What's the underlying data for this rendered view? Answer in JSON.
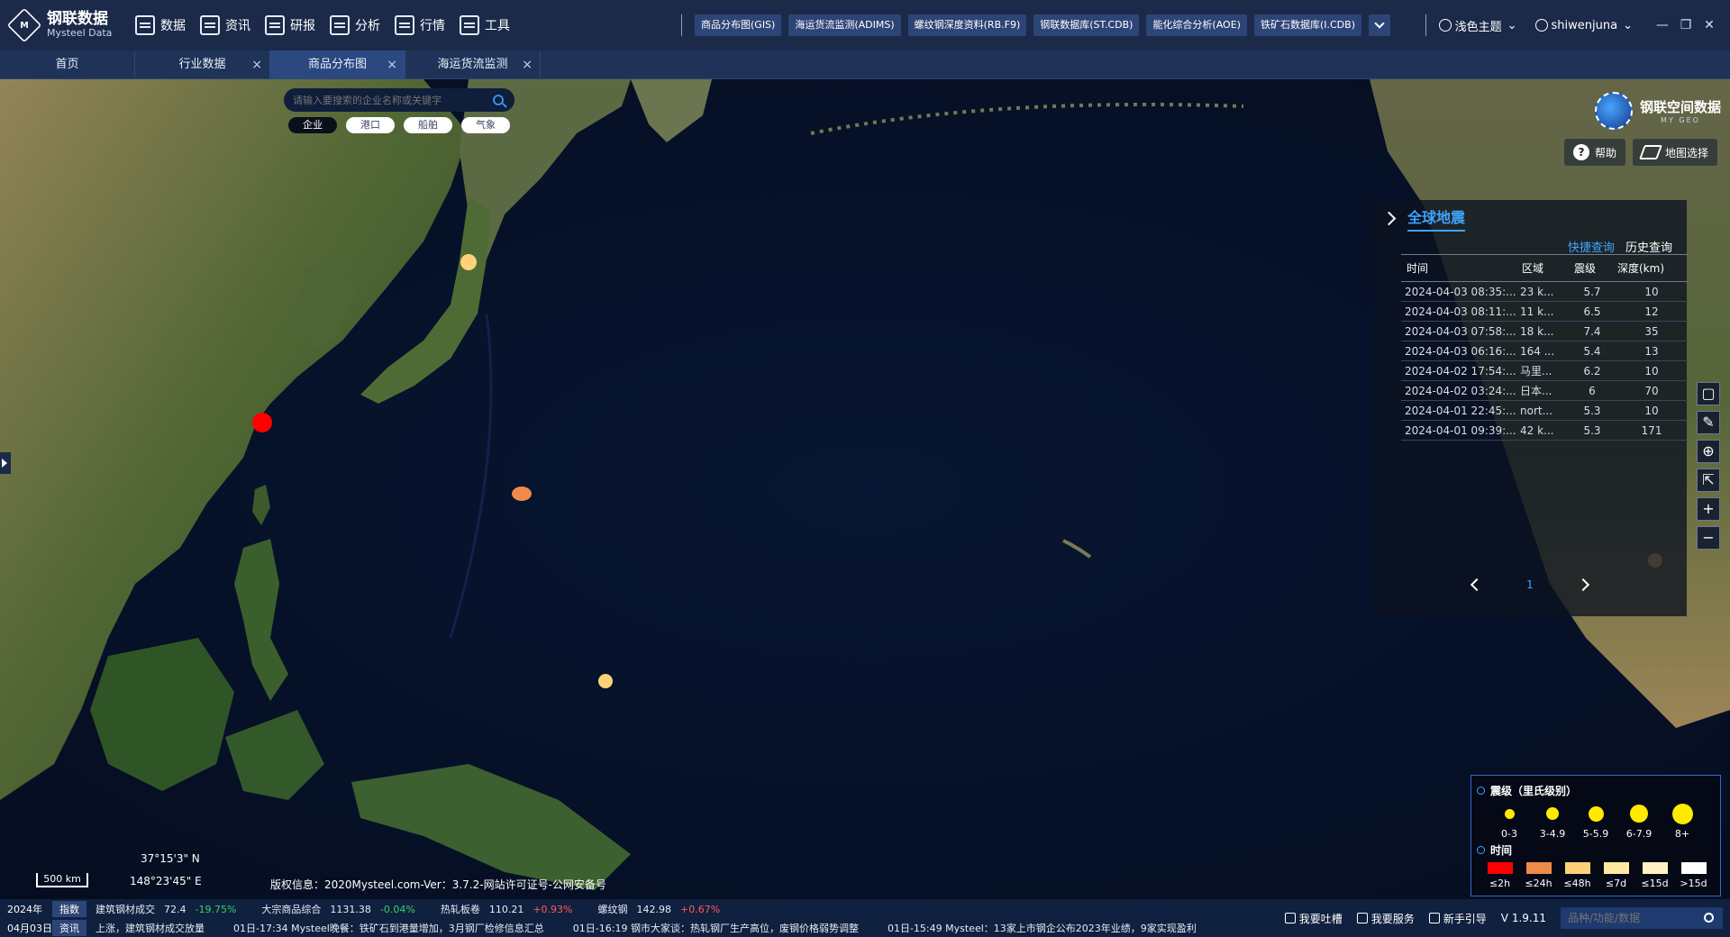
{
  "app": {
    "logo_cn": "钢联数据",
    "logo_en": "Mysteel Data",
    "nav": [
      {
        "label": "数据",
        "icon": "bar-chart-icon"
      },
      {
        "label": "资讯",
        "icon": "news-icon"
      },
      {
        "label": "研报",
        "icon": "report-icon"
      },
      {
        "label": "分析",
        "icon": "analysis-icon"
      },
      {
        "label": "行情",
        "icon": "market-icon"
      },
      {
        "label": "工具",
        "icon": "toolbox-icon"
      }
    ],
    "databases": [
      "商品分布图(GIS)",
      "海运货流监测(ADIMS)",
      "螺纹钢深度资料(RB.F9)",
      "钢联数据库(ST.CDB)",
      "能化综合分析(AOE)",
      "铁矿石数据库(I.CDB)"
    ],
    "theme": "浅色主题",
    "user": "shiwenjuna"
  },
  "tabs": [
    {
      "label": "首页",
      "closable": false,
      "active": false
    },
    {
      "label": "行业数据",
      "closable": true,
      "active": false
    },
    {
      "label": "商品分布图",
      "closable": true,
      "active": true
    },
    {
      "label": "海运货流监测",
      "closable": true,
      "active": false
    }
  ],
  "map": {
    "search_placeholder": "请输入要搜索的企业名称或关键字",
    "categories": [
      "企业",
      "港口",
      "船舶",
      "气象"
    ],
    "brand_cn": "钢联空间数据",
    "brand_en": "MY GEO",
    "help": "帮助",
    "map_select": "地图选择",
    "scale": "500 km",
    "lat": "37°15'3\" N",
    "lon": "148°23'45\" E",
    "copyright": "版权信息：2020Mysteel.com-Ver：3.7.2-网站许可证号-公网安备号"
  },
  "quake": {
    "title": "全球地震",
    "quick": "快捷查询",
    "history": "历史查询",
    "headers": [
      "时间",
      "区域",
      "震级",
      "深度(km)"
    ],
    "rows": [
      [
        "2024-04-03 08:35:...",
        "23 k...",
        "5.7",
        "10"
      ],
      [
        "2024-04-03 08:11:...",
        "11 k...",
        "6.5",
        "12"
      ],
      [
        "2024-04-03 07:58:...",
        "18 k...",
        "7.4",
        "35"
      ],
      [
        "2024-04-03 06:16:...",
        "164 ...",
        "5.4",
        "13"
      ],
      [
        "2024-04-02 17:54:...",
        "马里...",
        "6.2",
        "10"
      ],
      [
        "2024-04-02 03:24:...",
        "日本...",
        "6",
        "70"
      ],
      [
        "2024-04-01 22:45:...",
        "nort...",
        "5.3",
        "10"
      ],
      [
        "2024-04-01 09:39:...",
        "42 k...",
        "5.3",
        "171"
      ]
    ],
    "page": "1"
  },
  "legend": {
    "mag_title": "震级（里氏级别）",
    "mags": [
      "0-3",
      "3-4.9",
      "5-5.9",
      "6-7.9",
      "8+"
    ],
    "time_title": "时间",
    "times": [
      "≤2h",
      "≤24h",
      "≤48h",
      "≤7d",
      "≤15d",
      ">15d"
    ],
    "time_colors": [
      "#ff0000",
      "#ef8a4a",
      "#ffd27a",
      "#ffe9a0",
      "#fff3c4",
      "#ffffff"
    ]
  },
  "markers": [
    {
      "label": "Japan quake",
      "color": "#ffd27a"
    },
    {
      "label": "Taiwan quake",
      "color": "#ff0000"
    },
    {
      "label": "Mariana quake",
      "color": "#ef8a4a"
    },
    {
      "label": "PNG quake",
      "color": "#ffd27a"
    },
    {
      "label": "Pacific quake",
      "color": "#ffd27a"
    }
  ],
  "ticker": {
    "year": "2024年",
    "date": "04月03日",
    "tag1": "指数",
    "tag2": "资讯",
    "items": [
      {
        "name": "建筑钢材成交",
        "value": "72.4",
        "change": "-19.75%",
        "dir": "down"
      },
      {
        "name": "大宗商品综合",
        "value": "1131.38",
        "change": "-0.04%",
        "dir": "down"
      },
      {
        "name": "热轧板卷",
        "value": "110.21",
        "change": "+0.93%",
        "dir": "up"
      },
      {
        "name": "螺纹钢",
        "value": "142.98",
        "change": "+0.67%",
        "dir": "up"
      }
    ],
    "news": [
      "上涨，建筑钢材成交放量",
      "01日-17:34 Mysteel晚餐：铁矿石到港量增加，3月钢厂检修信息汇总",
      "01日-16:19 钢市大家谈：热轧钢厂生产高位，废钢价格弱势调整",
      "01日-15:49 Mysteel：13家上市钢企公布2023年业绩，9家实现盈利"
    ],
    "links": [
      "我要吐槽",
      "我要服务",
      "新手引导",
      "V 1.9.11"
    ],
    "search_placeholder": "品种/功能/数据"
  }
}
